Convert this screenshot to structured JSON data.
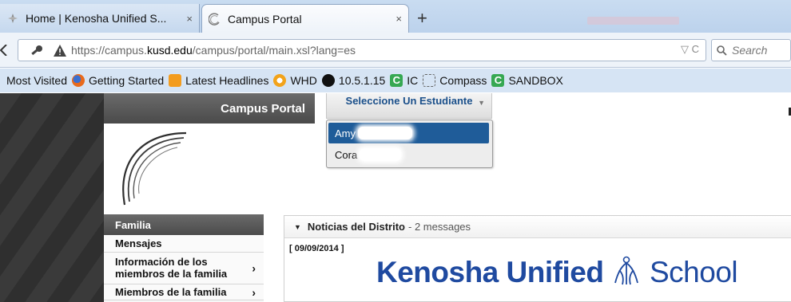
{
  "browser": {
    "tabs": [
      {
        "title": "Home | Kenosha Unified S...",
        "close": "×",
        "active": false
      },
      {
        "title": "Campus Portal",
        "close": "×",
        "active": true
      }
    ],
    "new_tab": "+",
    "url": {
      "prefix": "https://campus.",
      "domain": "kusd.edu",
      "path": "/campus/portal/main.xsl?lang=es"
    },
    "url_controls": "▽ C",
    "search_placeholder": "Search",
    "bookmarks": [
      {
        "label": "Most Visited",
        "icon": "none"
      },
      {
        "label": "Getting Started",
        "icon": "firefox-icon"
      },
      {
        "label": "Latest Headlines",
        "icon": "rss-icon"
      },
      {
        "label": "WHD",
        "icon": "whd-icon"
      },
      {
        "label": "10.5.1.15",
        "icon": "motorola-icon"
      },
      {
        "label": "IC",
        "icon": "campus-c-icon"
      },
      {
        "label": "Compass",
        "icon": "dotted-folder-icon"
      },
      {
        "label": "SANDBOX",
        "icon": "campus-c-icon"
      }
    ]
  },
  "portal": {
    "title": "Campus Portal",
    "student_selector": {
      "label": "Seleccione Un Estudiante",
      "options": [
        {
          "name": "Amy",
          "selected": true
        },
        {
          "name": "Cora",
          "selected": false
        }
      ]
    },
    "sidebar": {
      "header": "Familia",
      "items": [
        {
          "label": "Mensajes",
          "has_arrow": false
        },
        {
          "label": "Información de los miembros de la familia",
          "has_arrow": true
        },
        {
          "label": "Miembros de la familia",
          "has_arrow": true
        }
      ]
    },
    "news": {
      "title": "Noticias del Distrito",
      "count": " - 2 messages",
      "date": "[ 09/09/2014 ]",
      "banner_brand": "Kenosha Unified",
      "banner_suffix": "School"
    }
  },
  "colors": {
    "selected_option": "#1f5c99",
    "selector_label": "#1a4f8a",
    "kusd_blue": "#1f4aa0",
    "nav_header": "#555555"
  }
}
